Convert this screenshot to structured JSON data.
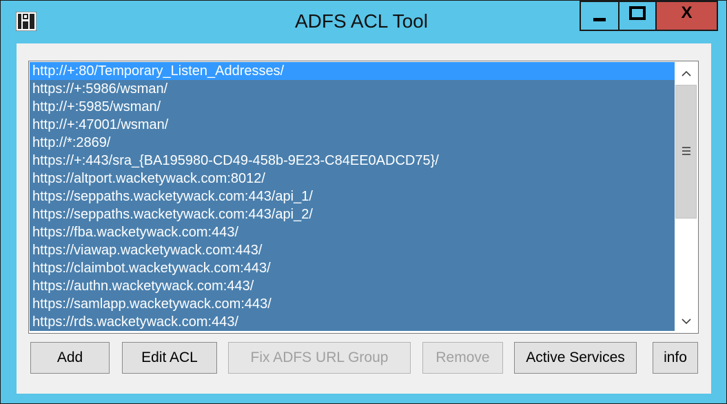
{
  "window": {
    "title": "ADFS ACL Tool",
    "icon": "adfs-app-icon",
    "controls": {
      "minimize": "minimize-icon",
      "maximize": "maximize-icon",
      "close_label": "X"
    }
  },
  "acl_list": {
    "selected_index": 0,
    "items": [
      "http://+:80/Temporary_Listen_Addresses/",
      "https://+:5986/wsman/",
      "http://+:5985/wsman/",
      "http://+:47001/wsman/",
      "http://*:2869/",
      "https://+:443/sra_{BA195980-CD49-458b-9E23-C84EE0ADCD75}/",
      "https://altport.wacketywack.com:8012/",
      "https://seppaths.wacketywack.com:443/api_1/",
      "https://seppaths.wacketywack.com:443/api_2/",
      "https://fba.wacketywack.com:443/",
      "https://viawap.wacketywack.com:443/",
      "https://claimbot.wacketywack.com:443/",
      "https://authn.wacketywack.com:443/",
      "https://samlapp.wacketywack.com:443/",
      "https://rds.wacketywack.com:443/"
    ]
  },
  "buttons": {
    "add": "Add",
    "edit_acl": "Edit ACL",
    "fix_adfs_url_group": "Fix ADFS URL Group",
    "remove": "Remove",
    "active_services": "Active Services",
    "info": "info"
  },
  "colors": {
    "titlebar": "#59c5e8",
    "close": "#c7504a",
    "selection": "#4a7fad",
    "focused_selection": "#3399ff"
  }
}
